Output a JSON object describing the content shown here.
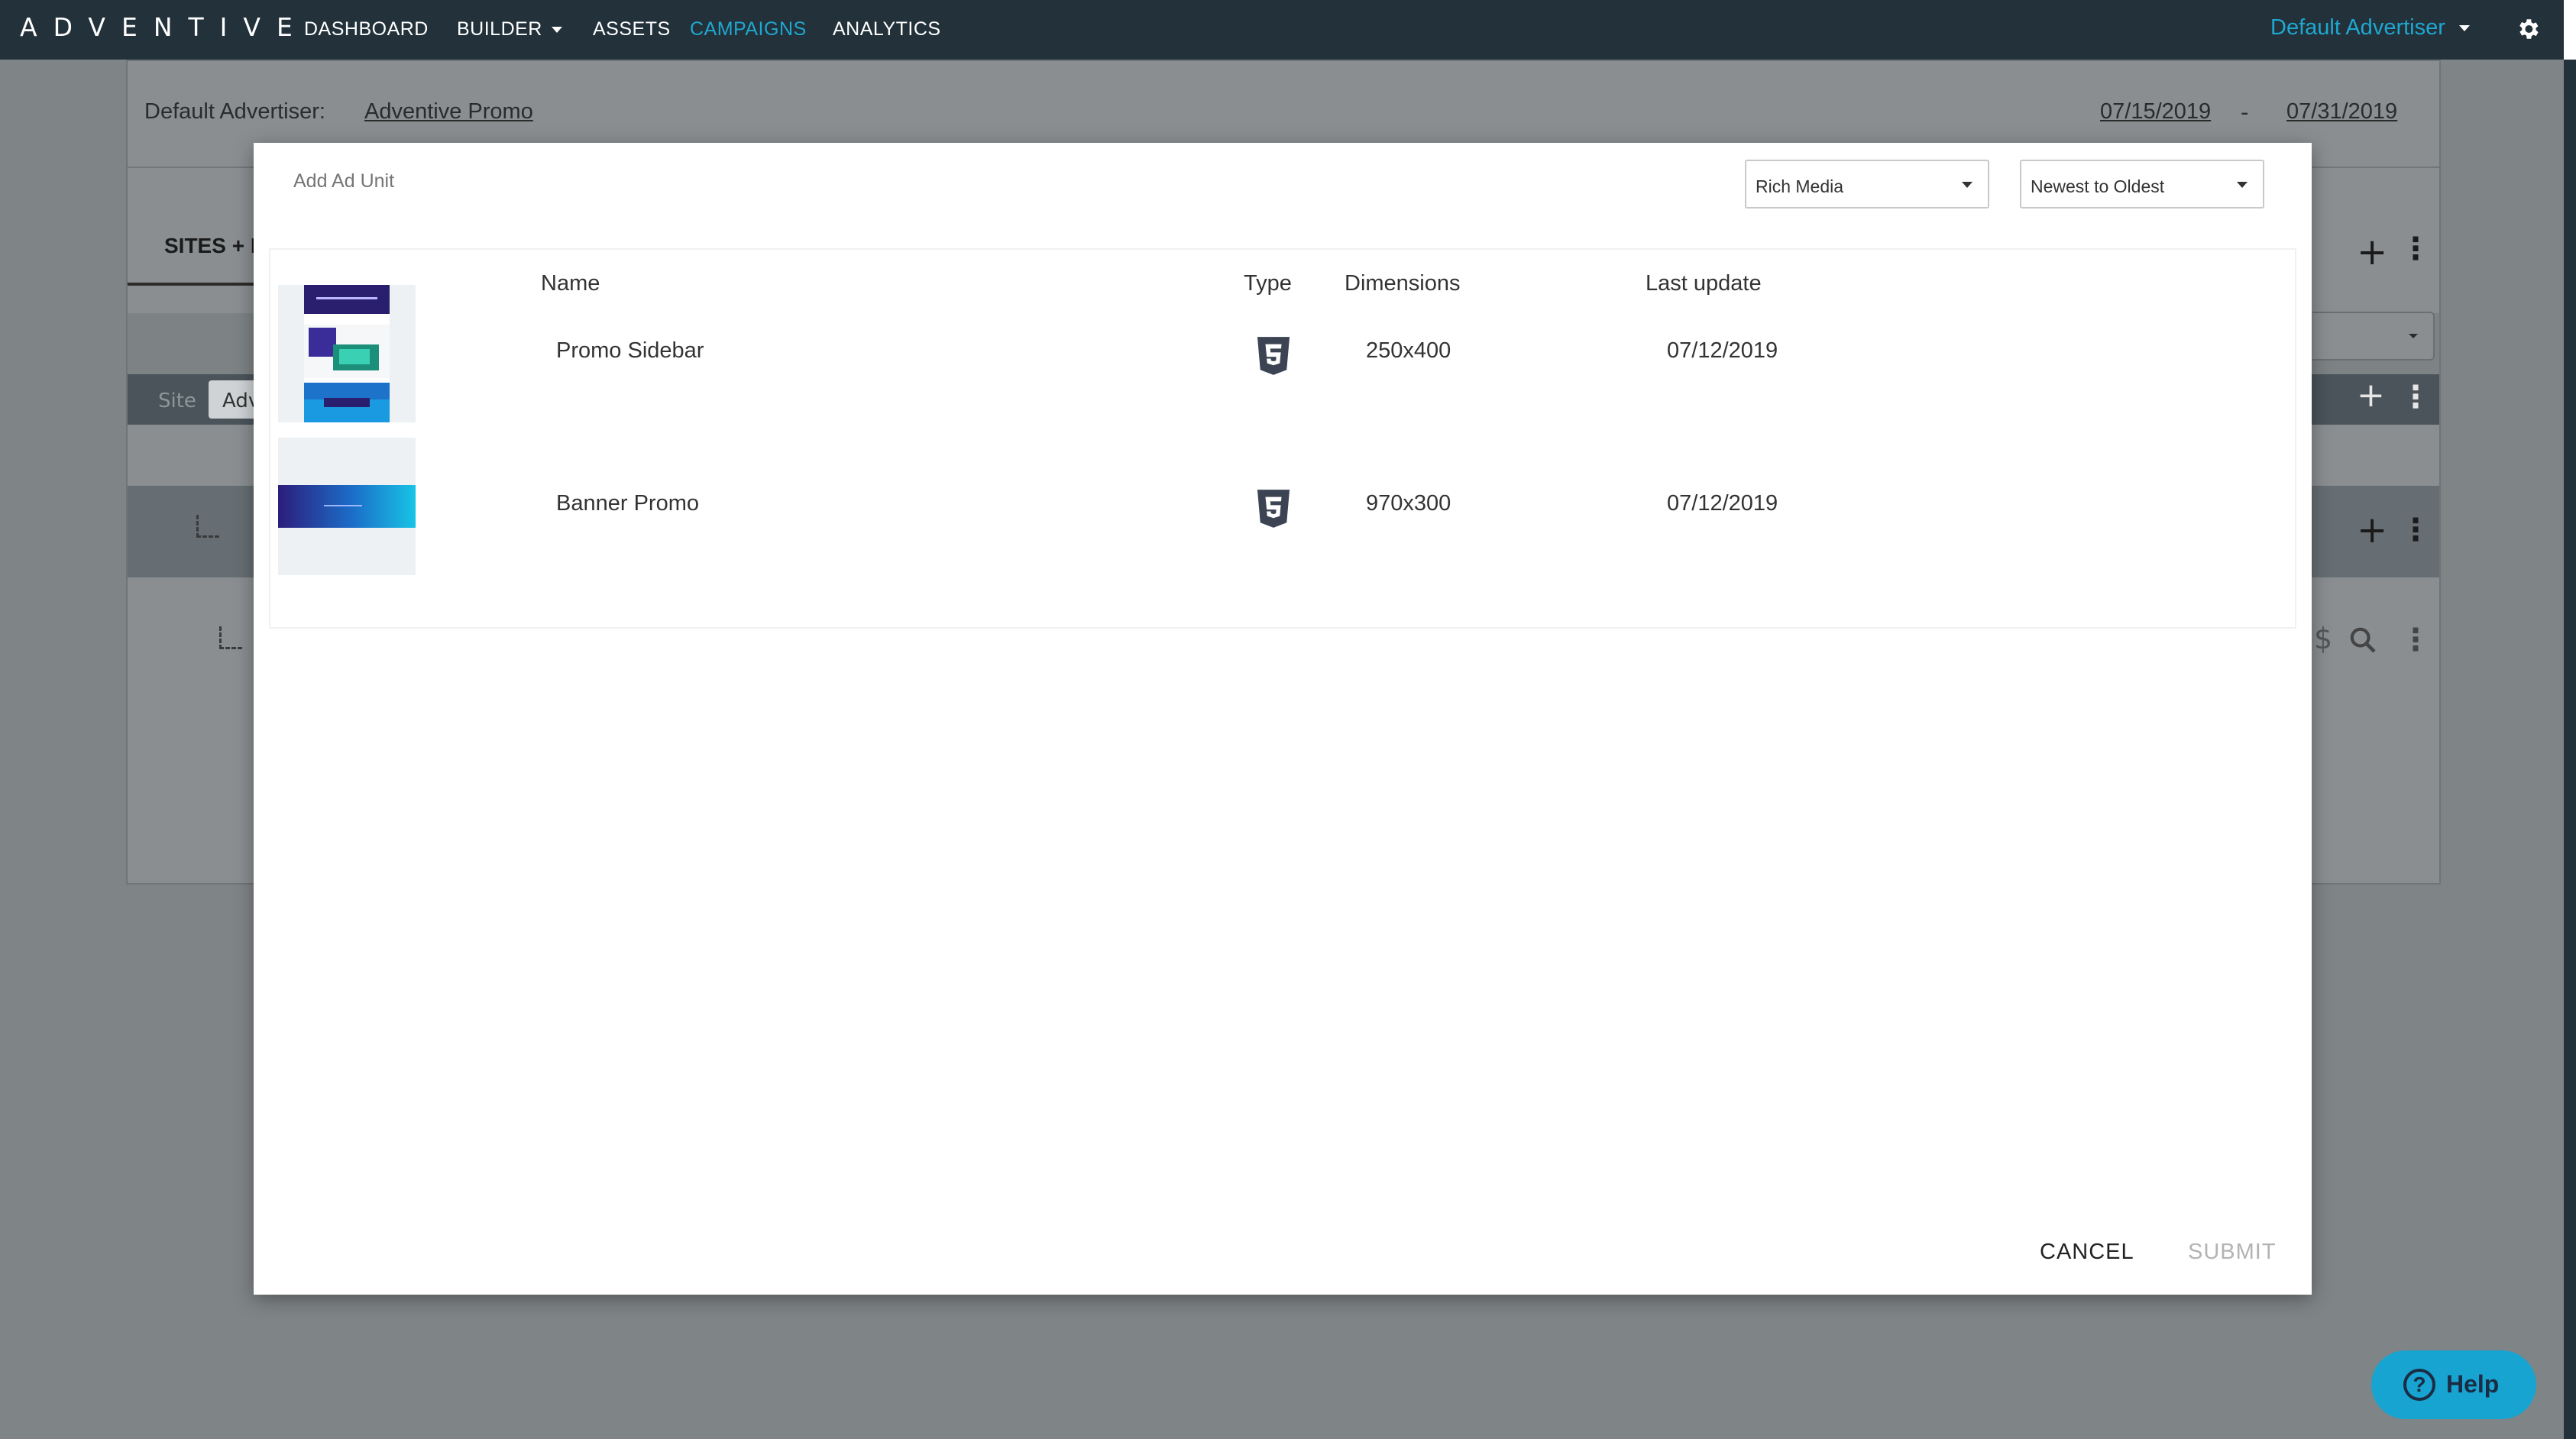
{
  "nav": {
    "logo": "ADVENTIVE",
    "items": [
      {
        "label": "DASHBOARD"
      },
      {
        "label": "BUILDER"
      },
      {
        "label": "ASSETS"
      },
      {
        "label": "CAMPAIGNS"
      },
      {
        "label": "ANALYTICS"
      }
    ],
    "active_item": "CAMPAIGNS",
    "advertiser": "Default Advertiser",
    "accent_color": "#1fa7d1",
    "settings_icon": "gear-icon"
  },
  "background": {
    "advertiser_label": "Default Advertiser:",
    "campaign_link": "Adventive Promo",
    "start_date": "07/15/2019",
    "date_separator": "-",
    "end_date": "07/31/2019",
    "tab_label": "SITES + I",
    "site_label": "Site",
    "site_value": "Adv"
  },
  "modal": {
    "title": "Add Ad Unit",
    "type_filter": "Rich Media",
    "sort_filter": "Newest to Oldest",
    "columns": {
      "name": "Name",
      "type": "Type",
      "dimensions": "Dimensions",
      "last_update": "Last update"
    },
    "rows": [
      {
        "name": "Promo Sidebar",
        "type_icon": "html5-icon",
        "dimensions": "250x400",
        "last_update": "07/12/2019"
      },
      {
        "name": "Banner Promo",
        "type_icon": "html5-icon",
        "dimensions": "970x300",
        "last_update": "07/12/2019"
      }
    ],
    "cancel_label": "CANCEL",
    "submit_label": "SUBMIT"
  },
  "help": {
    "label": "Help",
    "color": "#17a4d1"
  }
}
